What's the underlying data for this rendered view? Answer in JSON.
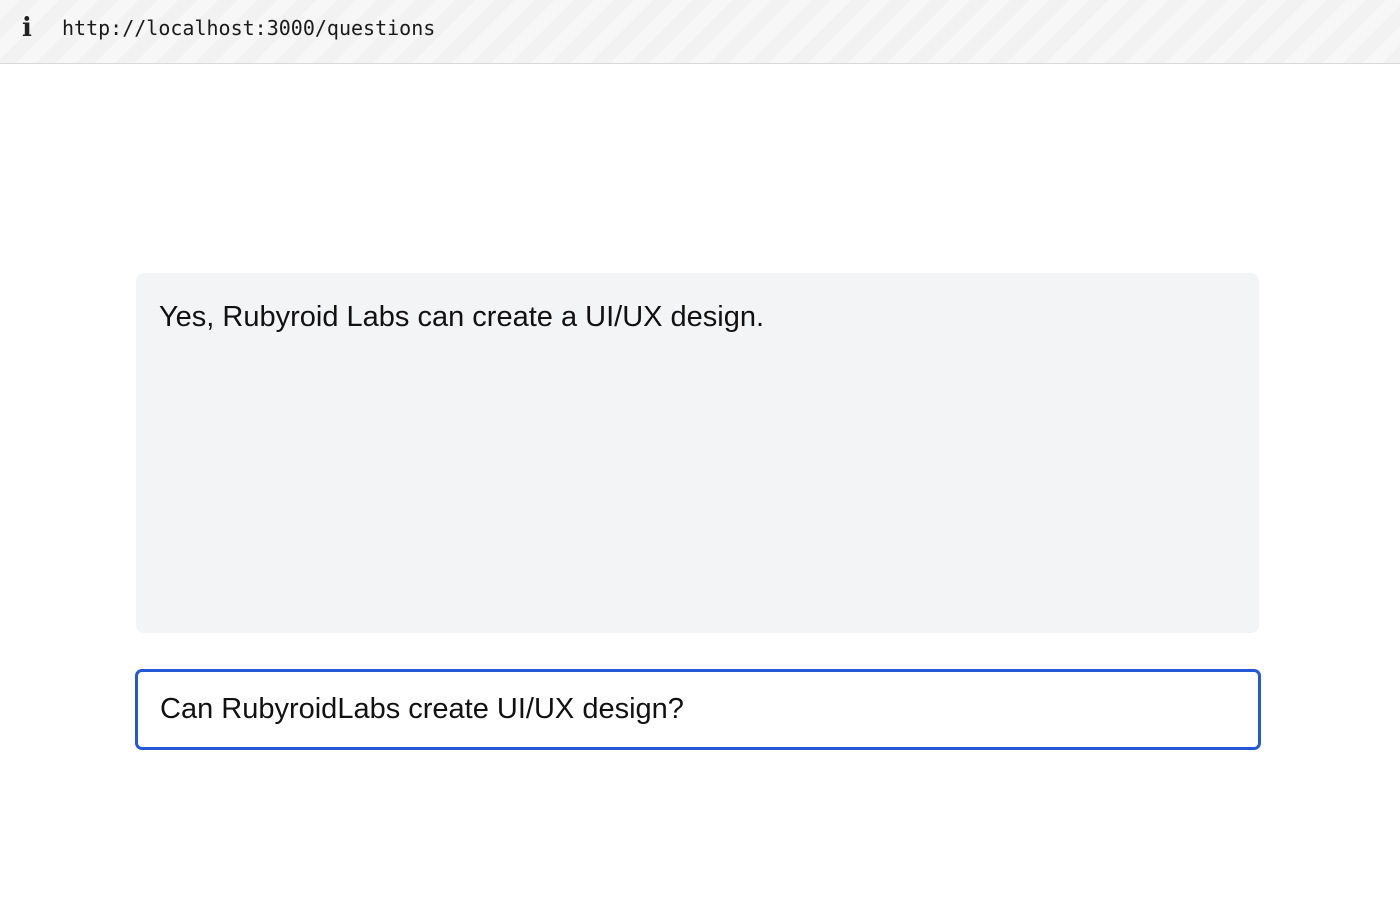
{
  "browser": {
    "info_icon": "info-icon",
    "url": "http://localhost:3000/questions"
  },
  "answer": {
    "text": "Yes, Rubyroid Labs can create a UI/UX design."
  },
  "question_input": {
    "value": "Can RubyroidLabs create UI/UX design?"
  },
  "colors": {
    "answer_background": "#f3f4f6",
    "input_focus_border": "#2458d6"
  }
}
